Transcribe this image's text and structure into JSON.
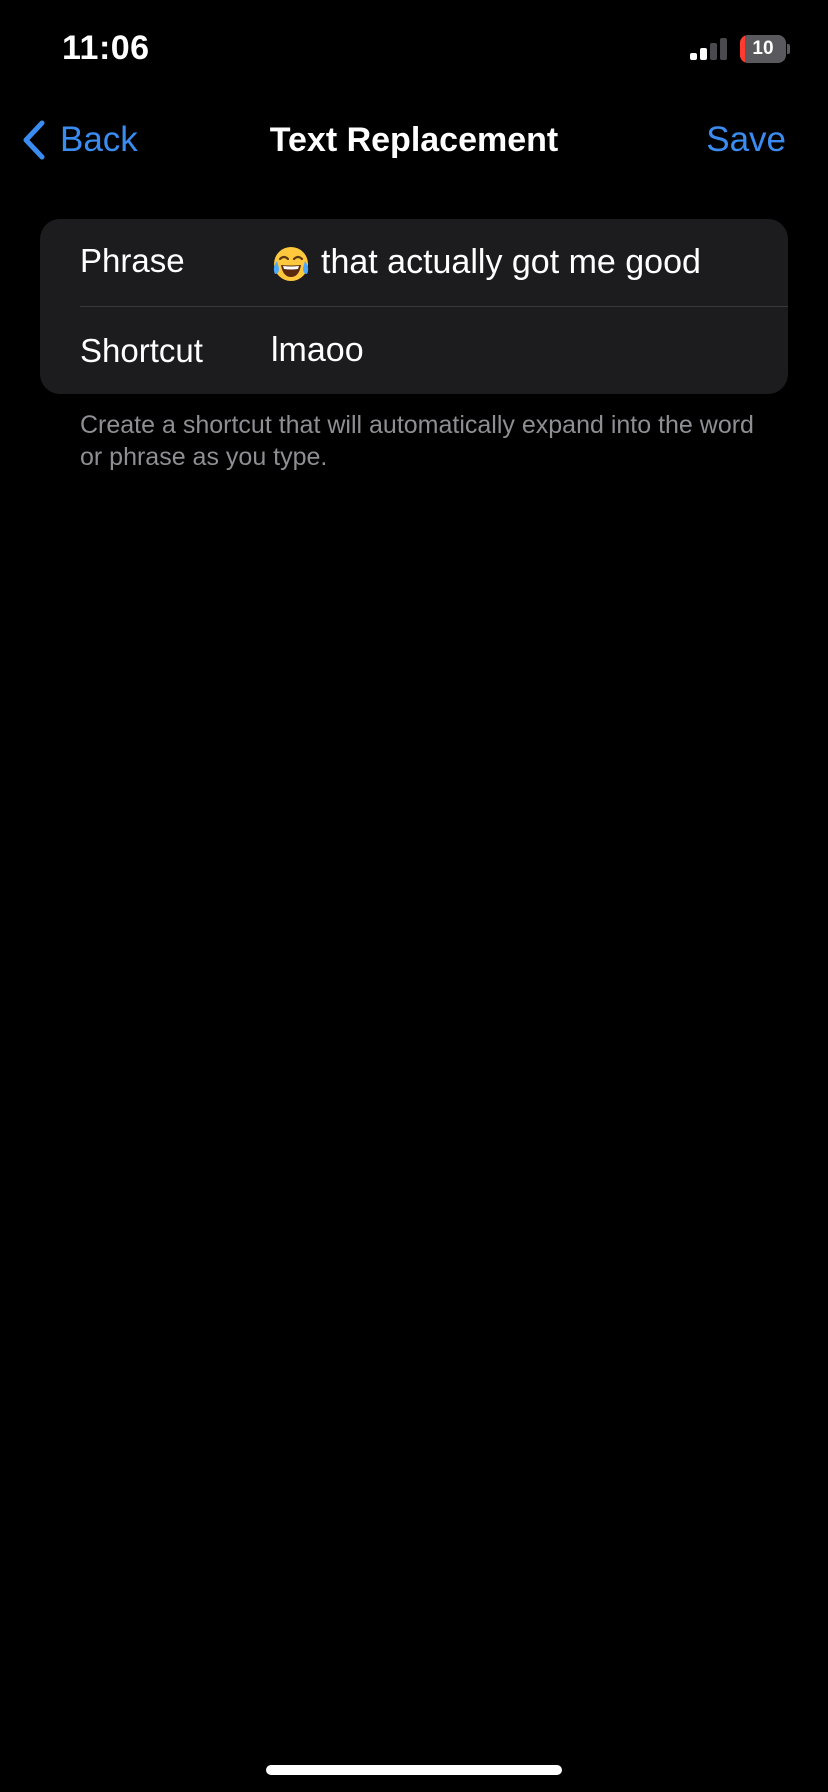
{
  "status_bar": {
    "time": "11:06",
    "battery_level": "10",
    "battery_fraction": 0.1,
    "signal_bars_active": 2,
    "signal_bars_total": 4,
    "battery_icon": "battery-charging-icon",
    "signal_icon": "cellular-signal-icon"
  },
  "nav": {
    "back_label": "Back",
    "title": "Text Replacement",
    "save_label": "Save",
    "back_icon": "chevron-left-icon"
  },
  "form": {
    "phrase_label": "Phrase",
    "phrase_emoji": "face-with-tears-of-joy-icon",
    "phrase_value": "that actually got me good",
    "shortcut_label": "Shortcut",
    "shortcut_value": "lmaoo"
  },
  "footer": {
    "note": "Create a shortcut that will automatically expand into the word or phrase as you type."
  },
  "colors": {
    "background": "#000000",
    "card": "#1c1c1e",
    "accent": "#3a8cf0",
    "secondary_text": "#8e8e93",
    "battery_low": "#ff3b30"
  }
}
